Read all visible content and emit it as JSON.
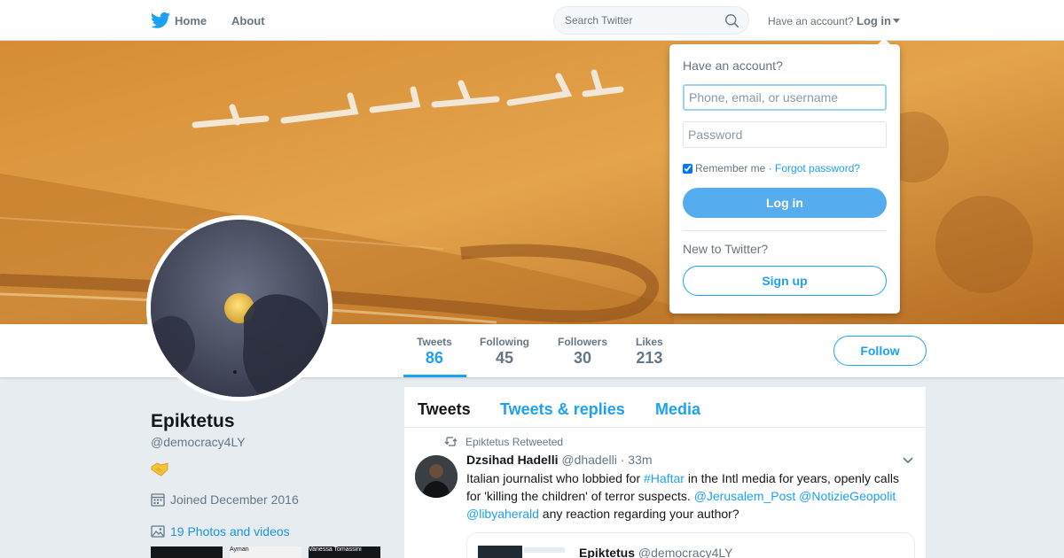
{
  "nav": {
    "home_label": "Home",
    "about_label": "About",
    "search_placeholder": "Search Twitter",
    "have_account": "Have an account?",
    "login_label": "Log in"
  },
  "profile": {
    "name": "Epiktetus",
    "handle": "@democracy4LY",
    "joined": "Joined December 2016",
    "photos": "19 Photos and videos",
    "follow_label": "Follow",
    "stats": [
      {
        "label": "Tweets",
        "value": "86"
      },
      {
        "label": "Following",
        "value": "45"
      },
      {
        "label": "Followers",
        "value": "30"
      },
      {
        "label": "Likes",
        "value": "213"
      }
    ],
    "thumbs": [
      {
        "text": "",
        "dark": true
      },
      {
        "text": "Ayman",
        "dark": false
      },
      {
        "text": "Vanessa Tomassini",
        "dark": true
      }
    ]
  },
  "timeline": {
    "tabs": [
      "Tweets",
      "Tweets & replies",
      "Media"
    ],
    "tweet": {
      "retweeted_by": "Epiktetus Retweeted",
      "name": "Dzsihad Hadelli",
      "handle": "@dhadelli",
      "time": "· 33m",
      "text_1": "Italian journalist who lobbied for ",
      "hashtag": "#Haftar",
      "text_2": " in the Intl media for years, openly calls for 'killing the children' of terror suspects. ",
      "mention_1": "@Jerusalem_Post",
      "mention_2": "@NotizieGeopolit",
      "mention_3": "@libyaherald",
      "text_3": " any reaction regarding your author?",
      "quote_name": "Epiktetus",
      "quote_handle": "@democracy4LY"
    }
  },
  "login": {
    "title": "Have an account?",
    "user_placeholder": "Phone, email, or username",
    "password_placeholder": "Password",
    "remember": "Remember me",
    "separator": " · ",
    "forgot": "Forgot password?",
    "login_button": "Log in",
    "new_label": "New to Twitter?",
    "signup_button": "Sign up"
  },
  "colors": {
    "accent": "#1da1f2",
    "login_button": "#55acee",
    "banner": "#c97e2a"
  }
}
